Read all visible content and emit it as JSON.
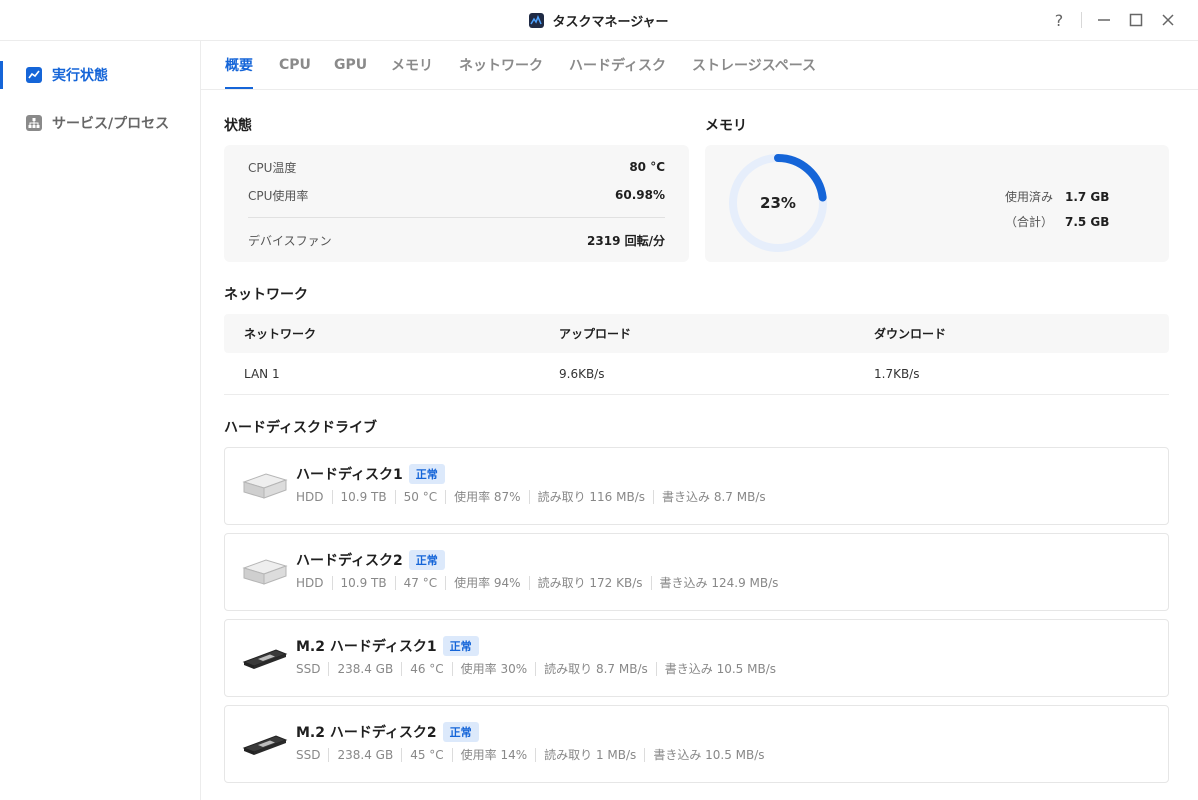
{
  "window": {
    "title": "タスクマネージャー",
    "help_label": "?"
  },
  "colors": {
    "accent": "#1565d8",
    "badge_bg": "#dce9fb",
    "card_bg": "#f7f7f7"
  },
  "sidebar": {
    "items": [
      {
        "label": "実行状態",
        "icon": "chart-line-icon",
        "active": true
      },
      {
        "label": "サービス/プロセス",
        "icon": "hierarchy-icon",
        "active": false
      }
    ]
  },
  "tabs": [
    {
      "label": "概要",
      "active": true
    },
    {
      "label": "CPU",
      "active": false
    },
    {
      "label": "GPU",
      "active": false
    },
    {
      "label": "メモリ",
      "active": false
    },
    {
      "label": "ネットワーク",
      "active": false
    },
    {
      "label": "ハードディスク",
      "active": false
    },
    {
      "label": "ストレージスペース",
      "active": false
    }
  ],
  "status": {
    "title": "状態",
    "rows": [
      {
        "label": "CPU温度",
        "value": "80 °C"
      },
      {
        "label": "CPU使用率",
        "value": "60.98%"
      },
      {
        "label": "デバイスファン",
        "value": "2319 回転/分"
      }
    ]
  },
  "memory": {
    "title": "メモリ",
    "percent": 23,
    "percent_label": "23%",
    "used_label": "使用済み",
    "used_value": "1.7 GB",
    "total_label": "（合計）",
    "total_value": "7.5 GB"
  },
  "network": {
    "title": "ネットワーク",
    "columns": [
      "ネットワーク",
      "アップロード",
      "ダウンロード"
    ],
    "rows": [
      [
        "LAN 1",
        "9.6KB/s",
        "1.7KB/s"
      ]
    ]
  },
  "disks": {
    "title": "ハードディスクドライブ",
    "items": [
      {
        "name": "ハードディスク1",
        "badge": "正常",
        "kind": "hdd-icon",
        "meta": [
          "HDD",
          "10.9 TB",
          "50 °C",
          "使用率 87%",
          "読み取り 116 MB/s",
          "書き込み 8.7 MB/s"
        ]
      },
      {
        "name": "ハードディスク2",
        "badge": "正常",
        "kind": "hdd-icon",
        "meta": [
          "HDD",
          "10.9 TB",
          "47 °C",
          "使用率 94%",
          "読み取り 172 KB/s",
          "書き込み 124.9 MB/s"
        ]
      },
      {
        "name": "M.2 ハードディスク1",
        "badge": "正常",
        "kind": "ssd-icon",
        "meta": [
          "SSD",
          "238.4 GB",
          "46 °C",
          "使用率 30%",
          "読み取り 8.7 MB/s",
          "書き込み 10.5 MB/s"
        ]
      },
      {
        "name": "M.2 ハードディスク2",
        "badge": "正常",
        "kind": "ssd-icon",
        "meta": [
          "SSD",
          "238.4 GB",
          "45 °C",
          "使用率 14%",
          "読み取り 1 MB/s",
          "書き込み 10.5 MB/s"
        ]
      }
    ]
  }
}
